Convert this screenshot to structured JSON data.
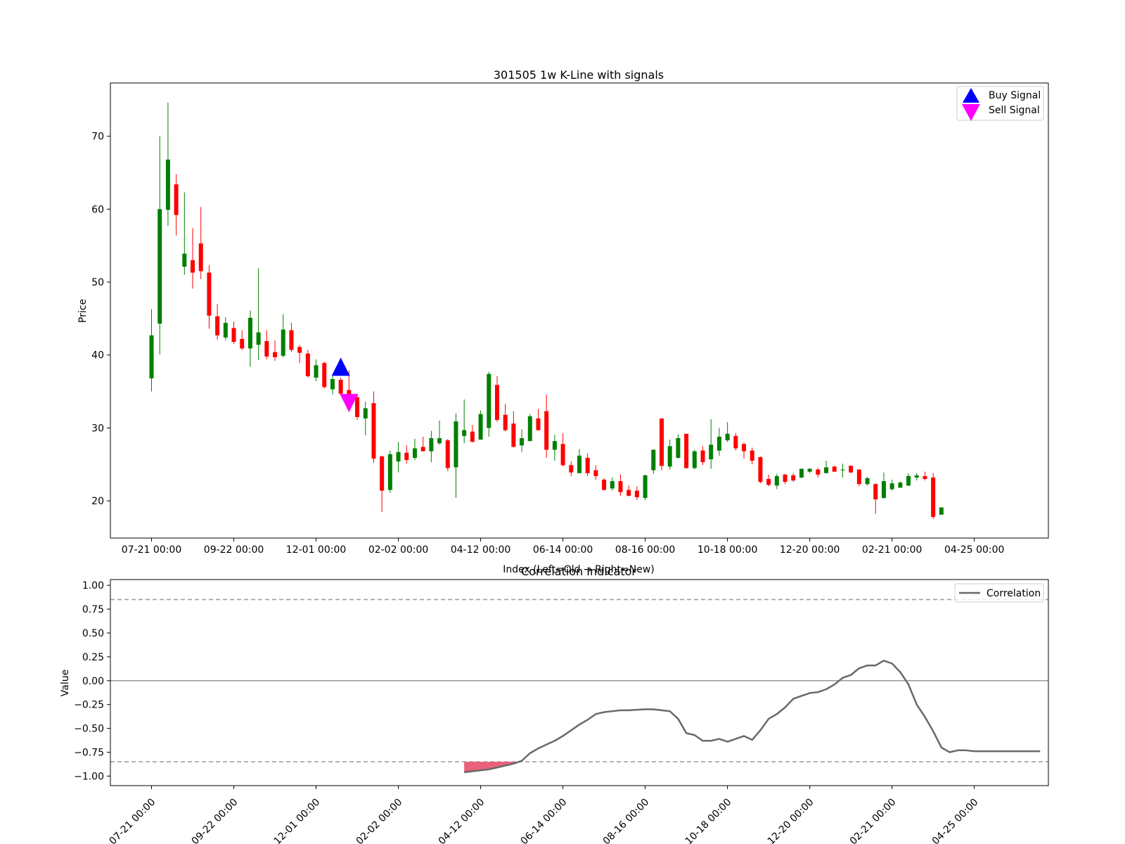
{
  "chart_data": [
    {
      "type": "candlestick",
      "title": "301505 1w K-Line with signals",
      "xlabel": "Index (Left=Old → Right=New)",
      "ylabel": "Price",
      "ylim": [
        14.9,
        77.3
      ],
      "xlim": [
        -5,
        109
      ],
      "yticks": [
        20,
        30,
        40,
        50,
        60,
        70
      ],
      "xtick_indices": [
        0,
        10,
        20,
        30,
        40,
        50,
        60,
        70,
        80,
        90,
        100
      ],
      "xtick_labels": [
        "07-21 00:00",
        "09-22 00:00",
        "12-01 00:00",
        "02-02 00:00",
        "04-12 00:00",
        "06-14 00:00",
        "08-16 00:00",
        "10-18 00:00",
        "12-20 00:00",
        "02-21 00:00",
        "04-25 00:00"
      ],
      "colors": {
        "up": "#008000",
        "down": "#ff0000",
        "buy": "#0000ff",
        "sell": "#ff00ff"
      },
      "legend": {
        "placement": "upper right",
        "entries": [
          "Buy Signal",
          "Sell Signal"
        ]
      },
      "candles": [
        [
          0,
          36.8,
          42.7,
          46.3,
          35.0
        ],
        [
          1,
          44.3,
          60.0,
          70.0,
          40.1
        ],
        [
          2,
          59.9,
          66.8,
          74.6,
          57.7
        ],
        [
          3,
          63.4,
          59.2,
          64.8,
          56.4
        ],
        [
          4,
          52.1,
          53.9,
          62.3,
          51.0
        ],
        [
          5,
          53.0,
          51.3,
          57.4,
          49.1
        ],
        [
          6,
          55.3,
          51.5,
          60.3,
          50.4
        ],
        [
          7,
          51.3,
          45.4,
          52.3,
          43.6
        ],
        [
          8,
          45.3,
          42.7,
          47.0,
          42.1
        ],
        [
          9,
          42.4,
          44.4,
          45.2,
          42.0
        ],
        [
          10,
          43.7,
          41.8,
          44.6,
          41.5
        ],
        [
          11,
          42.2,
          40.9,
          43.4,
          40.7
        ],
        [
          12,
          40.9,
          45.1,
          46.1,
          38.4
        ],
        [
          13,
          41.4,
          43.1,
          51.9,
          39.3
        ],
        [
          14,
          41.9,
          39.8,
          43.4,
          39.4
        ],
        [
          15,
          40.4,
          39.7,
          42.0,
          39.2
        ],
        [
          16,
          39.9,
          43.5,
          45.6,
          39.7
        ],
        [
          17,
          43.4,
          40.7,
          44.4,
          40.4
        ],
        [
          18,
          41.1,
          40.3,
          41.4,
          38.9
        ],
        [
          19,
          40.2,
          37.1,
          40.7,
          36.9
        ],
        [
          20,
          36.9,
          38.6,
          39.4,
          36.4
        ],
        [
          21,
          38.9,
          35.6,
          39.1,
          35.4
        ],
        [
          22,
          35.3,
          36.7,
          37.1,
          34.6
        ],
        [
          23,
          36.6,
          34.7,
          36.9,
          34.5
        ],
        [
          24,
          35.2,
          34.2,
          37.9,
          33.9
        ],
        [
          25,
          34.2,
          31.5,
          34.7,
          31.1
        ],
        [
          26,
          31.3,
          32.7,
          33.6,
          29.0
        ],
        [
          27,
          33.4,
          25.8,
          35.0,
          25.2
        ],
        [
          28,
          26.1,
          21.4,
          26.2,
          18.5
        ],
        [
          29,
          21.5,
          26.4,
          26.9,
          21.1
        ],
        [
          30,
          25.4,
          26.7,
          28.1,
          23.9
        ],
        [
          31,
          26.6,
          25.6,
          27.6,
          25.1
        ],
        [
          32,
          25.9,
          27.2,
          28.5,
          25.6
        ],
        [
          33,
          27.4,
          26.8,
          28.8,
          26.8
        ],
        [
          34,
          26.8,
          28.6,
          29.6,
          25.3
        ],
        [
          35,
          27.9,
          28.6,
          31.0,
          27.7
        ],
        [
          36,
          28.3,
          24.5,
          28.5,
          24.1
        ],
        [
          37,
          24.6,
          30.9,
          32.0,
          20.4
        ],
        [
          38,
          28.9,
          29.7,
          33.9,
          27.9
        ],
        [
          39,
          29.5,
          28.1,
          30.4,
          28.0
        ],
        [
          40,
          28.4,
          31.9,
          32.4,
          28.4
        ],
        [
          41,
          30.0,
          37.4,
          37.7,
          28.8
        ],
        [
          42,
          35.9,
          31.1,
          37.1,
          30.8
        ],
        [
          43,
          31.8,
          29.7,
          33.3,
          29.5
        ],
        [
          44,
          30.6,
          27.4,
          32.3,
          27.3
        ],
        [
          45,
          27.6,
          28.6,
          29.8,
          26.7
        ],
        [
          46,
          28.2,
          31.6,
          31.9,
          28.2
        ],
        [
          47,
          31.3,
          29.7,
          32.6,
          29.6
        ],
        [
          48,
          32.3,
          27.0,
          34.6,
          25.9
        ],
        [
          49,
          27.0,
          28.2,
          29.1,
          25.5
        ],
        [
          50,
          27.8,
          24.9,
          29.3,
          24.7
        ],
        [
          51,
          24.9,
          23.9,
          25.4,
          23.4
        ],
        [
          52,
          23.8,
          26.2,
          27.1,
          23.8
        ],
        [
          53,
          25.9,
          23.8,
          26.5,
          23.4
        ],
        [
          54,
          24.2,
          23.4,
          24.9,
          22.9
        ],
        [
          55,
          22.9,
          21.5,
          23.1,
          21.4
        ],
        [
          56,
          21.7,
          22.7,
          23.2,
          21.4
        ],
        [
          57,
          22.7,
          21.2,
          23.6,
          20.7
        ],
        [
          58,
          21.5,
          20.7,
          22.1,
          20.6
        ],
        [
          59,
          21.4,
          20.5,
          22.0,
          20.1
        ],
        [
          60,
          20.4,
          23.5,
          23.6,
          20.1
        ],
        [
          61,
          24.2,
          27.0,
          27.1,
          23.7
        ],
        [
          62,
          31.3,
          24.8,
          31.3,
          24.2
        ],
        [
          63,
          24.7,
          27.5,
          28.4,
          24.3
        ],
        [
          64,
          25.9,
          28.6,
          29.1,
          25.8
        ],
        [
          65,
          29.2,
          24.5,
          29.2,
          24.4
        ],
        [
          66,
          24.5,
          26.8,
          27.0,
          24.3
        ],
        [
          67,
          26.9,
          25.3,
          27.5,
          24.9
        ],
        [
          68,
          25.7,
          27.7,
          31.2,
          24.4
        ],
        [
          69,
          26.9,
          28.8,
          30.0,
          26.2
        ],
        [
          70,
          28.3,
          29.2,
          30.8,
          28.1
        ],
        [
          71,
          28.9,
          27.2,
          29.3,
          26.9
        ],
        [
          72,
          27.8,
          26.8,
          28.0,
          25.8
        ],
        [
          73,
          26.9,
          25.5,
          27.3,
          25.0
        ],
        [
          74,
          26.0,
          22.6,
          26.1,
          22.4
        ],
        [
          75,
          23.0,
          22.2,
          23.6,
          22.0
        ],
        [
          76,
          22.1,
          23.4,
          23.7,
          21.6
        ],
        [
          77,
          23.6,
          22.6,
          23.7,
          22.3
        ],
        [
          78,
          23.5,
          22.8,
          23.8,
          22.6
        ],
        [
          79,
          23.2,
          24.4,
          24.4,
          23.1
        ],
        [
          80,
          24.0,
          24.4,
          24.5,
          23.8
        ],
        [
          81,
          24.3,
          23.6,
          24.5,
          23.2
        ],
        [
          82,
          23.8,
          24.6,
          25.5,
          23.8
        ],
        [
          83,
          24.7,
          24.0,
          24.8,
          24.0
        ],
        [
          84,
          24.2,
          24.3,
          25.1,
          23.2
        ],
        [
          85,
          24.8,
          23.9,
          24.9,
          23.8
        ],
        [
          86,
          24.3,
          22.3,
          24.3,
          22.0
        ],
        [
          87,
          22.3,
          23.1,
          23.3,
          22.1
        ],
        [
          88,
          22.3,
          20.2,
          22.4,
          18.2
        ],
        [
          89,
          20.4,
          22.7,
          23.9,
          20.3
        ],
        [
          90,
          21.6,
          22.4,
          22.9,
          21.4
        ],
        [
          91,
          21.8,
          22.5,
          22.7,
          21.8
        ],
        [
          92,
          22.1,
          23.4,
          23.8,
          22.0
        ],
        [
          93,
          23.2,
          23.5,
          23.8,
          22.8
        ],
        [
          94,
          23.4,
          23.0,
          24.0,
          22.8
        ],
        [
          95,
          23.2,
          17.8,
          23.8,
          17.5
        ],
        [
          96,
          18.1,
          19.1,
          19.1,
          18.1
        ]
      ],
      "buy_signals": [
        {
          "x": 23,
          "y": 38.3
        }
      ],
      "sell_signals": [
        {
          "x": 24,
          "y": 33.5
        }
      ]
    },
    {
      "type": "line",
      "title": "Correlation Indicator",
      "xlabel": "",
      "ylabel": "Value",
      "ylim": [
        -1.1,
        1.06
      ],
      "xlim": [
        -5,
        109
      ],
      "yticks": [
        -1.0,
        -0.75,
        -0.5,
        -0.25,
        0.0,
        0.25,
        0.5,
        0.75,
        1.0
      ],
      "ytick_labels": [
        "−1.00",
        "−0.75",
        "−0.50",
        "−0.25",
        "0.00",
        "0.25",
        "0.50",
        "0.75",
        "1.00"
      ],
      "xtick_indices": [
        0,
        10,
        20,
        30,
        40,
        50,
        60,
        70,
        80,
        90,
        100
      ],
      "xtick_labels": [
        "07-21 00:00",
        "09-22 00:00",
        "12-01 00:00",
        "02-02 00:00",
        "04-12 00:00",
        "06-14 00:00",
        "08-16 00:00",
        "10-18 00:00",
        "12-20 00:00",
        "02-21 00:00",
        "04-25 00:00"
      ],
      "hlines": [
        {
          "y": 0.85,
          "style": "dashed"
        },
        {
          "y": -0.85,
          "style": "dashed"
        },
        {
          "y": 0,
          "style": "solid"
        }
      ],
      "legend": {
        "placement": "upper right",
        "entries": [
          "Correlation"
        ]
      },
      "colors": {
        "line": "#696969",
        "fill": "#e8506a",
        "hline": "#999999"
      },
      "fill_below": -0.85,
      "series": [
        {
          "name": "Correlation",
          "x": [
            38,
            39,
            40,
            41,
            42,
            43,
            44,
            45,
            46,
            47,
            48,
            49,
            50,
            51,
            52,
            53,
            54,
            55,
            56,
            57,
            58,
            59,
            60,
            61,
            62,
            63,
            64,
            65,
            66,
            67,
            68,
            69,
            70,
            71,
            72,
            73,
            74,
            75,
            76,
            77,
            78,
            79,
            80,
            81,
            82,
            83,
            84,
            85,
            86,
            87,
            88,
            89,
            90,
            91,
            92,
            93,
            94,
            95,
            96,
            97,
            98,
            99,
            100,
            101,
            102,
            103,
            104,
            105,
            106,
            107,
            108
          ],
          "y": [
            -0.96,
            -0.95,
            -0.94,
            -0.93,
            -0.91,
            -0.89,
            -0.87,
            -0.84,
            -0.76,
            -0.71,
            -0.67,
            -0.63,
            -0.58,
            -0.52,
            -0.46,
            -0.41,
            -0.35,
            -0.33,
            -0.32,
            -0.31,
            -0.31,
            -0.305,
            -0.3,
            -0.3,
            -0.31,
            -0.32,
            -0.4,
            -0.55,
            -0.57,
            -0.63,
            -0.63,
            -0.61,
            -0.64,
            -0.61,
            -0.58,
            -0.62,
            -0.52,
            -0.4,
            -0.35,
            -0.28,
            -0.19,
            -0.16,
            -0.13,
            -0.12,
            -0.09,
            -0.04,
            0.03,
            0.06,
            0.13,
            0.16,
            0.16,
            0.21,
            0.18,
            0.09,
            -0.04,
            -0.25,
            -0.38,
            -0.53,
            -0.7,
            -0.75,
            -0.73,
            -0.73,
            -0.74,
            -0.74,
            -0.74,
            -0.74,
            -0.74,
            -0.74,
            -0.74,
            -0.74,
            -0.74
          ]
        }
      ]
    }
  ]
}
